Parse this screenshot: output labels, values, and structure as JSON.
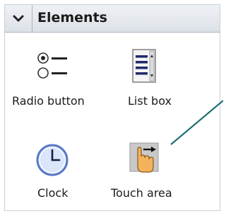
{
  "panel": {
    "title": "Elements"
  },
  "items": [
    {
      "label": "Radio button",
      "icon": "radio-button-icon"
    },
    {
      "label": "List box",
      "icon": "list-box-icon"
    },
    {
      "label": "Clock",
      "icon": "clock-icon"
    },
    {
      "label": "Touch area",
      "icon": "touch-area-icon"
    }
  ],
  "colors": {
    "accent": "#1f6f70",
    "header_bg": "#e6eaee",
    "clock_face": "#d9e6fb",
    "clock_ring": "#5a78c8",
    "touch_bg": "#c9c9c9",
    "hand": "#f2b35c"
  }
}
